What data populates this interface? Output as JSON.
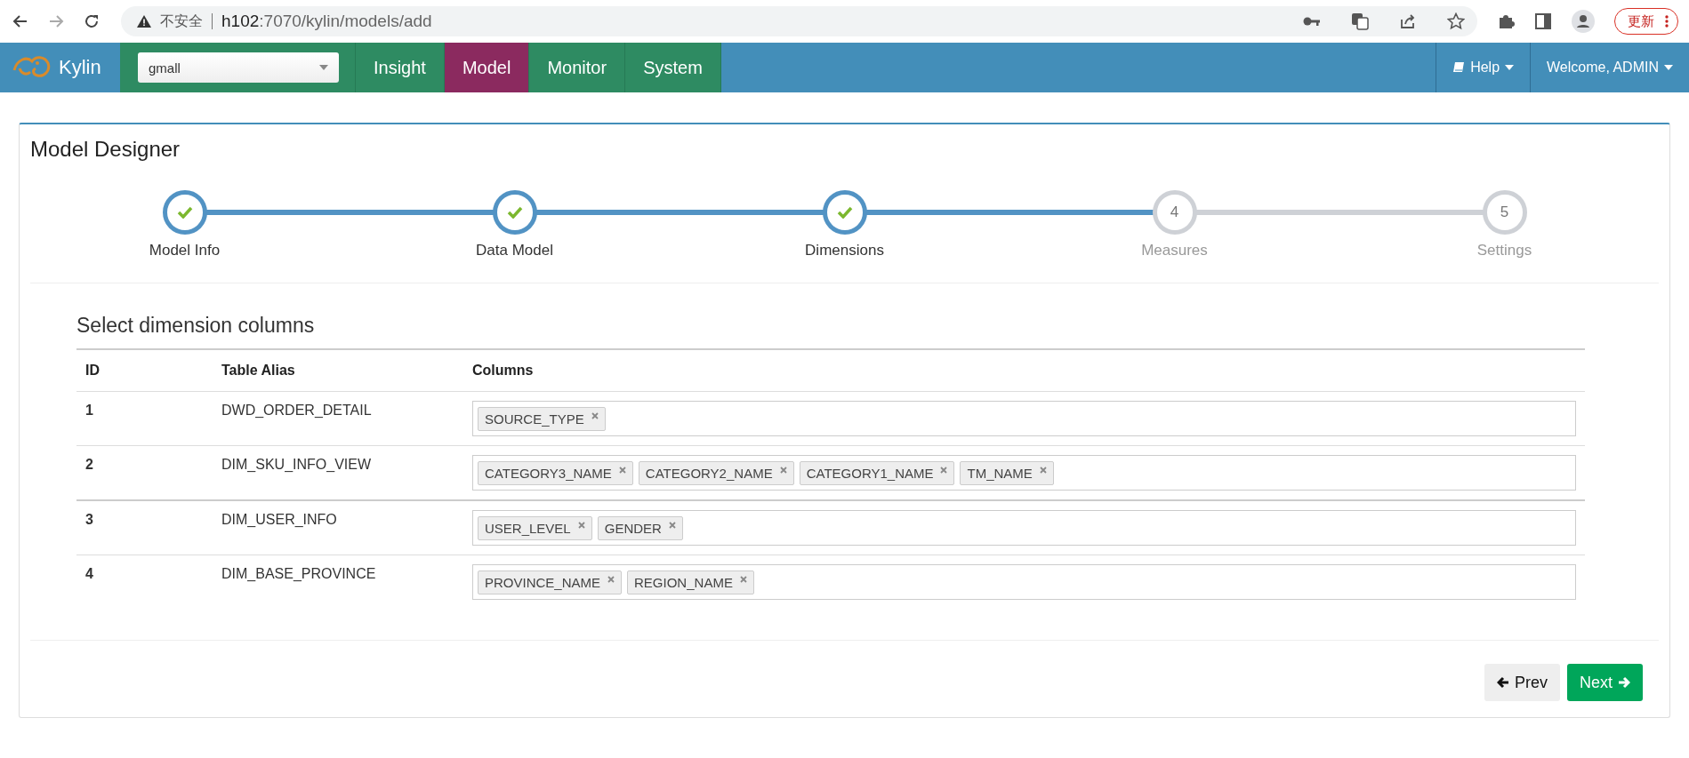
{
  "browser": {
    "security_label": "不安全",
    "url_host": "h102",
    "url_rest": ":7070/kylin/models/add",
    "update_button": "更新"
  },
  "navbar": {
    "brand": "Kylin",
    "project_select": {
      "value": "gmall"
    },
    "tabs": [
      {
        "label": "Insight",
        "selected": false
      },
      {
        "label": "Model",
        "selected": true
      },
      {
        "label": "Monitor",
        "selected": false
      },
      {
        "label": "System",
        "selected": false
      }
    ],
    "help": "Help",
    "user": "Welcome, ADMIN"
  },
  "card": {
    "title": "Model Designer",
    "steps": [
      {
        "label": "Model Info",
        "complete": true
      },
      {
        "label": "Data Model",
        "complete": true
      },
      {
        "label": "Dimensions",
        "complete": true
      },
      {
        "label": "Measures",
        "number": "4",
        "complete": false
      },
      {
        "label": "Settings",
        "number": "5",
        "complete": false
      }
    ],
    "section_title": "Select dimension columns",
    "table": {
      "columns": [
        "ID",
        "Table Alias",
        "Columns"
      ],
      "rows": [
        {
          "row_number": "1",
          "alias": "DWD_ORDER_DETAIL",
          "tags": [
            "SOURCE_TYPE"
          ]
        },
        {
          "row_number": "2",
          "alias": "DIM_SKU_INFO_VIEW",
          "tags": [
            "CATEGORY3_NAME",
            "CATEGORY2_NAME",
            "CATEGORY1_NAME",
            "TM_NAME"
          ]
        },
        {
          "row_number": "3",
          "alias": "DIM_USER_INFO",
          "tags": [
            "USER_LEVEL",
            "GENDER"
          ]
        },
        {
          "row_number": "4",
          "alias": "DIM_BASE_PROVINCE",
          "tags": [
            "PROVINCE_NAME",
            "REGION_NAME"
          ]
        }
      ]
    },
    "prev_button": "Prev",
    "next_button": "Next"
  }
}
